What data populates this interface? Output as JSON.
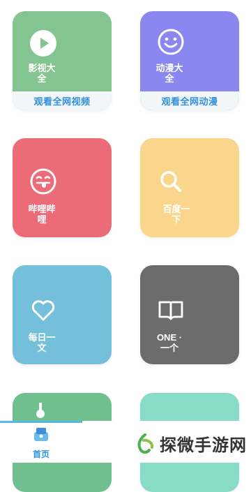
{
  "cards": {
    "video": {
      "label": "影视大\n全",
      "sub": "观看全网视频",
      "color": "#84c490"
    },
    "anime": {
      "label": "动漫大\n全",
      "sub": "观看全网动漫",
      "color": "#8a87f0"
    },
    "bilibili": {
      "label": "哔哩哔\n哩",
      "color": "#ec6b79"
    },
    "baidu": {
      "label": "百度一\n下",
      "color": "#f9d68c"
    },
    "daily": {
      "label": "每日一\n文",
      "color": "#74c0da"
    },
    "one": {
      "label": "ONE ·\n一个",
      "color": "#6c6c6c"
    },
    "partial_left": {
      "color": "#6fbf8f"
    },
    "partial_right": {
      "color": "#88dcc7"
    }
  },
  "tabbar": {
    "home_label": "首页",
    "accent": "#2f8fe0"
  },
  "watermark": {
    "text": "探微手游网"
  },
  "icons": [
    "play-icon",
    "smiley-icon",
    "tongue-face-icon",
    "search-icon",
    "heart-icon",
    "book-icon",
    "home-icon",
    "watermark-logo-icon"
  ]
}
